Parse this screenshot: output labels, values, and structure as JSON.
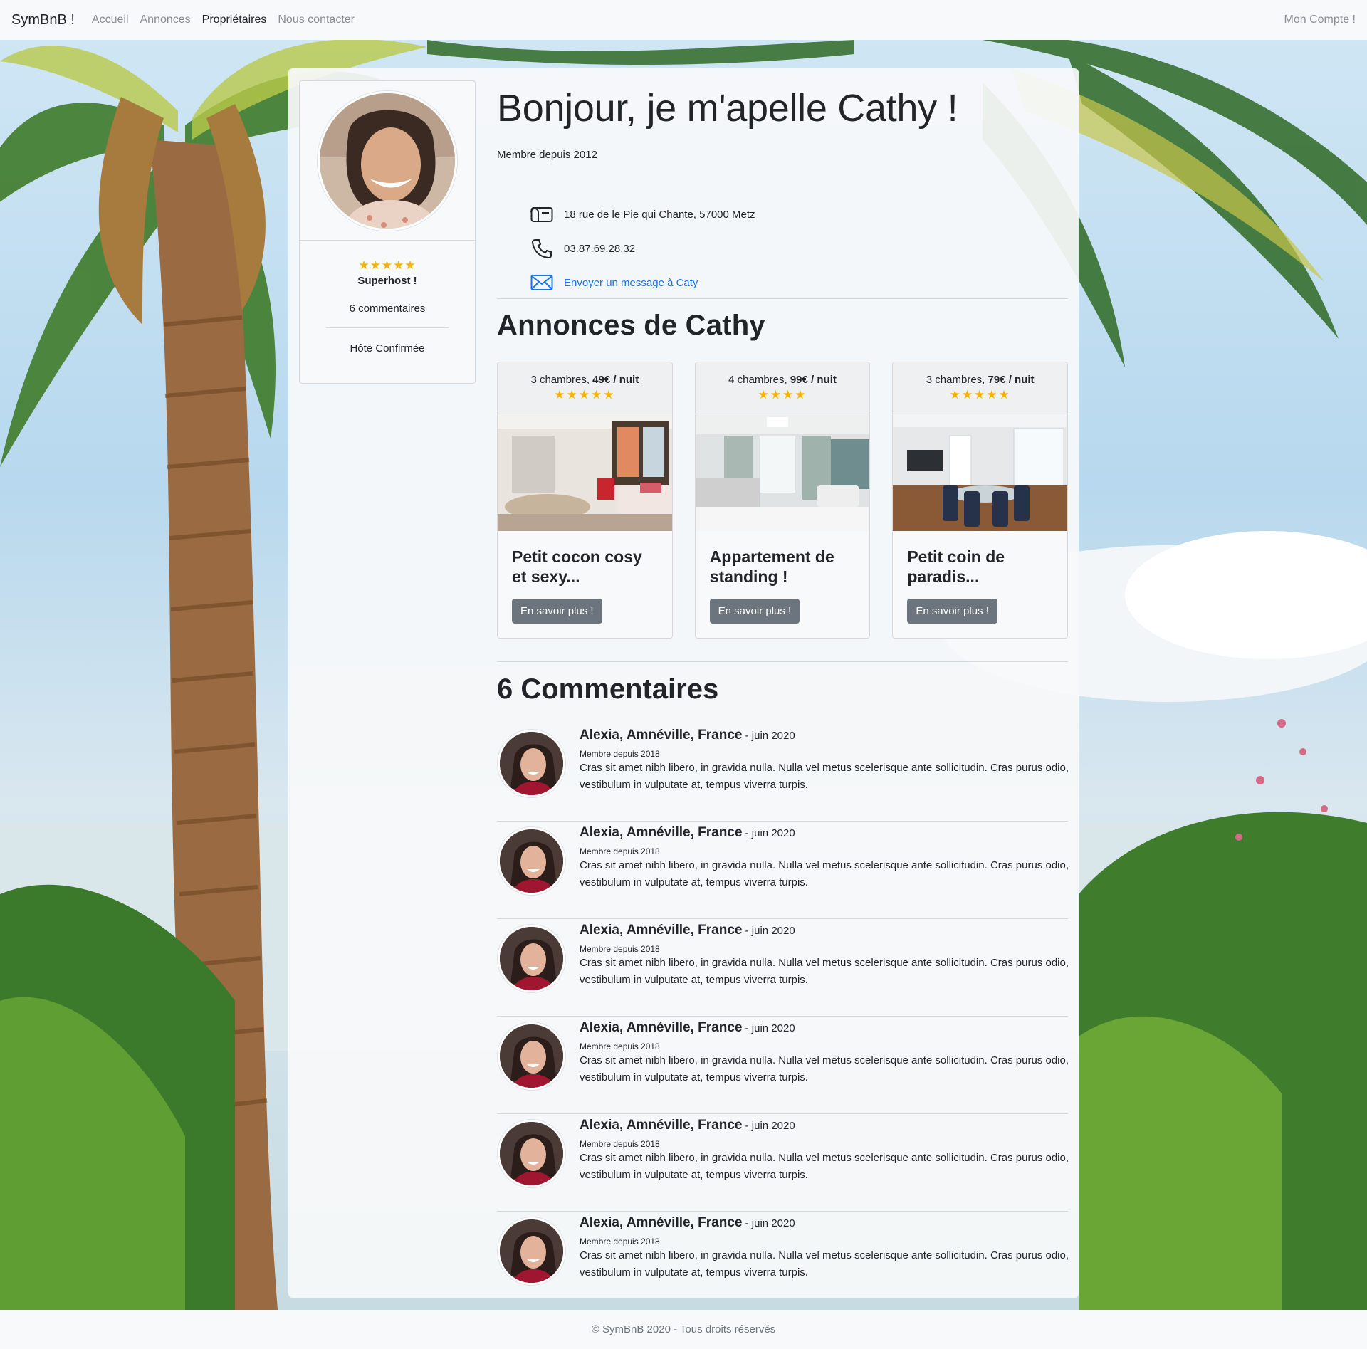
{
  "navbar": {
    "brand": "SymBnB !",
    "links": [
      "Accueil",
      "Annonces",
      "Propriétaires",
      "Nous contacter"
    ],
    "account": "Mon Compte !"
  },
  "profile": {
    "stars": "★★★★★",
    "badge": "Superhost !",
    "comments_count": "6 commentaires",
    "status": "Hôte Confirmée"
  },
  "header": {
    "greeting": "Bonjour, je m'apelle Cathy !",
    "member_since": "Membre depuis 2012"
  },
  "contact": {
    "address": "18 rue de le Pie qui Chante, 57000 Metz",
    "phone": "03.87.69.28.32",
    "message_link": "Envoyer un message à Caty",
    "icons": [
      "mailbox-icon",
      "phone-icon",
      "envelope-icon"
    ]
  },
  "ads_section": {
    "title": "Annonces de Cathy",
    "ads": [
      {
        "rooms": "3 chambres,",
        "price": "49€ / nuit",
        "stars": "★★★★★",
        "title": "Petit cocon cosy et sexy...",
        "button": "En savoir plus !"
      },
      {
        "rooms": "4 chambres,",
        "price": "99€ / nuit",
        "stars": "★★★★",
        "title": "Appartement de standing !",
        "button": "En savoir plus !"
      },
      {
        "rooms": "3 chambres,",
        "price": "79€ / nuit",
        "stars": "★★★★★",
        "title": "Petit coin de paradis...",
        "button": "En savoir plus !"
      }
    ]
  },
  "comments_section": {
    "title": "6 Commentaires",
    "items": [
      {
        "author": "Alexia, Amnéville, France",
        "date": " - juin 2020",
        "member": "Membre depuis 2018",
        "body": "Cras sit amet nibh libero, in gravida nulla. Nulla vel metus scelerisque ante sollicitudin. Cras purus odio, vestibulum in vulputate at, tempus viverra turpis."
      },
      {
        "author": "Alexia, Amnéville, France",
        "date": " - juin 2020",
        "member": "Membre depuis 2018",
        "body": "Cras sit amet nibh libero, in gravida nulla. Nulla vel metus scelerisque ante sollicitudin. Cras purus odio, vestibulum in vulputate at, tempus viverra turpis."
      },
      {
        "author": "Alexia, Amnéville, France",
        "date": " - juin 2020",
        "member": "Membre depuis 2018",
        "body": "Cras sit amet nibh libero, in gravida nulla. Nulla vel metus scelerisque ante sollicitudin. Cras purus odio, vestibulum in vulputate at, tempus viverra turpis."
      },
      {
        "author": "Alexia, Amnéville, France",
        "date": " - juin 2020",
        "member": "Membre depuis 2018",
        "body": "Cras sit amet nibh libero, in gravida nulla. Nulla vel metus scelerisque ante sollicitudin. Cras purus odio, vestibulum in vulputate at, tempus viverra turpis."
      },
      {
        "author": "Alexia, Amnéville, France",
        "date": " - juin 2020",
        "member": "Membre depuis 2018",
        "body": "Cras sit amet nibh libero, in gravida nulla. Nulla vel metus scelerisque ante sollicitudin. Cras purus odio, vestibulum in vulputate at, tempus viverra turpis."
      },
      {
        "author": "Alexia, Amnéville, France",
        "date": " - juin 2020",
        "member": "Membre depuis 2018",
        "body": "Cras sit amet nibh libero, in gravida nulla. Nulla vel metus scelerisque ante sollicitudin. Cras purus odio, vestibulum in vulputate at, tempus viverra turpis."
      }
    ]
  },
  "footer": {
    "text": "© SymBnB 2020 - Tous droits réservés"
  },
  "colors": {
    "link": "#1a73e8",
    "star": "#f5b301",
    "button": "#6c757d"
  }
}
